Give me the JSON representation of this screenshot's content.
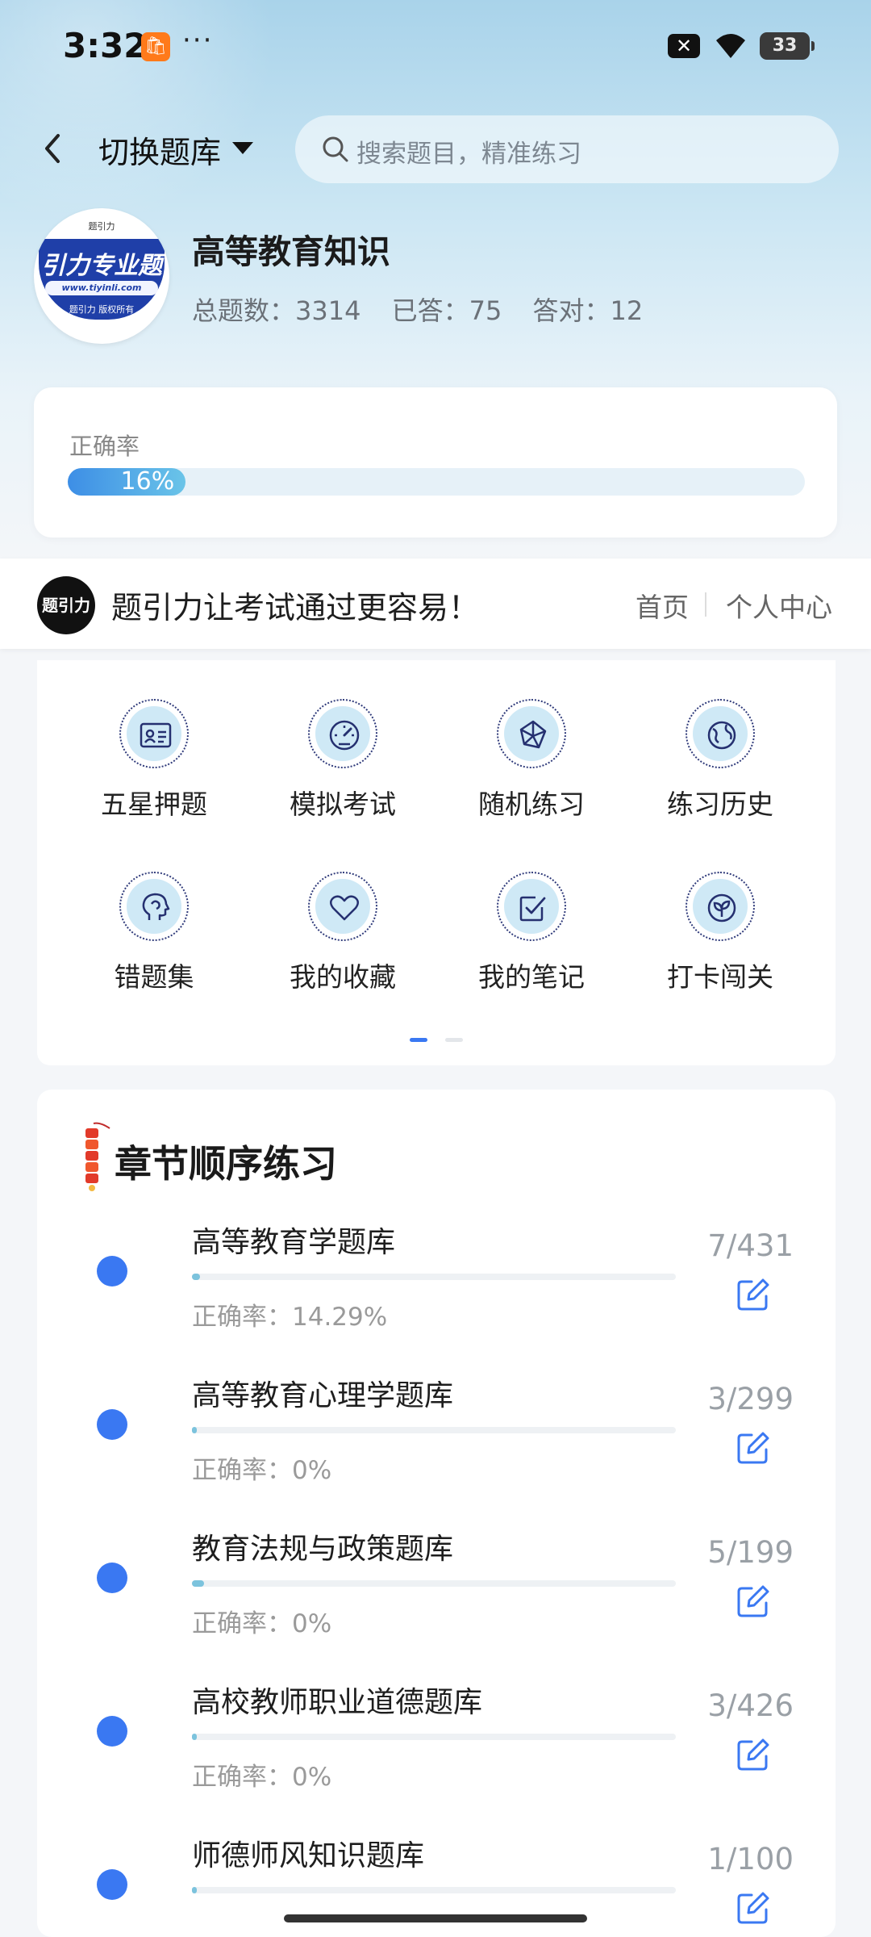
{
  "status_bar": {
    "time": "3:32",
    "dots": "···",
    "battery": "33"
  },
  "header": {
    "switch_label": "切换题库",
    "search_placeholder": "搜索题目，精准练习"
  },
  "bank": {
    "logo_text": "引力专业题",
    "logo_url": "www.tiyinli.com",
    "logo_copyright": "题引力 版权所有",
    "logo_top": "题引力",
    "title": "高等教育知识",
    "stats": [
      "总题数：3314",
      "已答：75",
      "答对：12"
    ]
  },
  "accuracy": {
    "label": "正确率",
    "value_text": "16%",
    "value": 0.16
  },
  "brand": {
    "logo_text": "题引力",
    "slogan": "题引力让考试通过更容易！",
    "home": "首页",
    "me": "个人中心"
  },
  "grid": {
    "items": [
      {
        "label": "五星押题",
        "icon": "id-card-icon"
      },
      {
        "label": "模拟考试",
        "icon": "speedometer-icon"
      },
      {
        "label": "随机练习",
        "icon": "network-icon"
      },
      {
        "label": "练习历史",
        "icon": "globe-icon"
      },
      {
        "label": "错题集",
        "icon": "head-icon"
      },
      {
        "label": "我的收藏",
        "icon": "heart-icon"
      },
      {
        "label": "我的笔记",
        "icon": "checkbox-icon"
      },
      {
        "label": "打卡闯关",
        "icon": "leaf-icon"
      }
    ],
    "page_index": 0,
    "page_count": 2
  },
  "chapters": {
    "title": "章节顺序练习",
    "items": [
      {
        "name": "高等教育学题库",
        "accuracy": "正确率：14.29%",
        "count": "7/431",
        "progress": 0.016
      },
      {
        "name": "高等教育心理学题库",
        "accuracy": "正确率：0%",
        "count": "3/299",
        "progress": 0.01
      },
      {
        "name": "教育法规与政策题库",
        "accuracy": "正确率：0%",
        "count": "5/199",
        "progress": 0.025
      },
      {
        "name": "高校教师职业道德题库",
        "accuracy": "正确率：0%",
        "count": "3/426",
        "progress": 0.007
      },
      {
        "name": "师德师风知识题库",
        "accuracy": "",
        "count": "1/100",
        "progress": 0.01
      }
    ]
  },
  "colors": {
    "accent": "#3a78f2",
    "progress": "#7cc3dd"
  }
}
